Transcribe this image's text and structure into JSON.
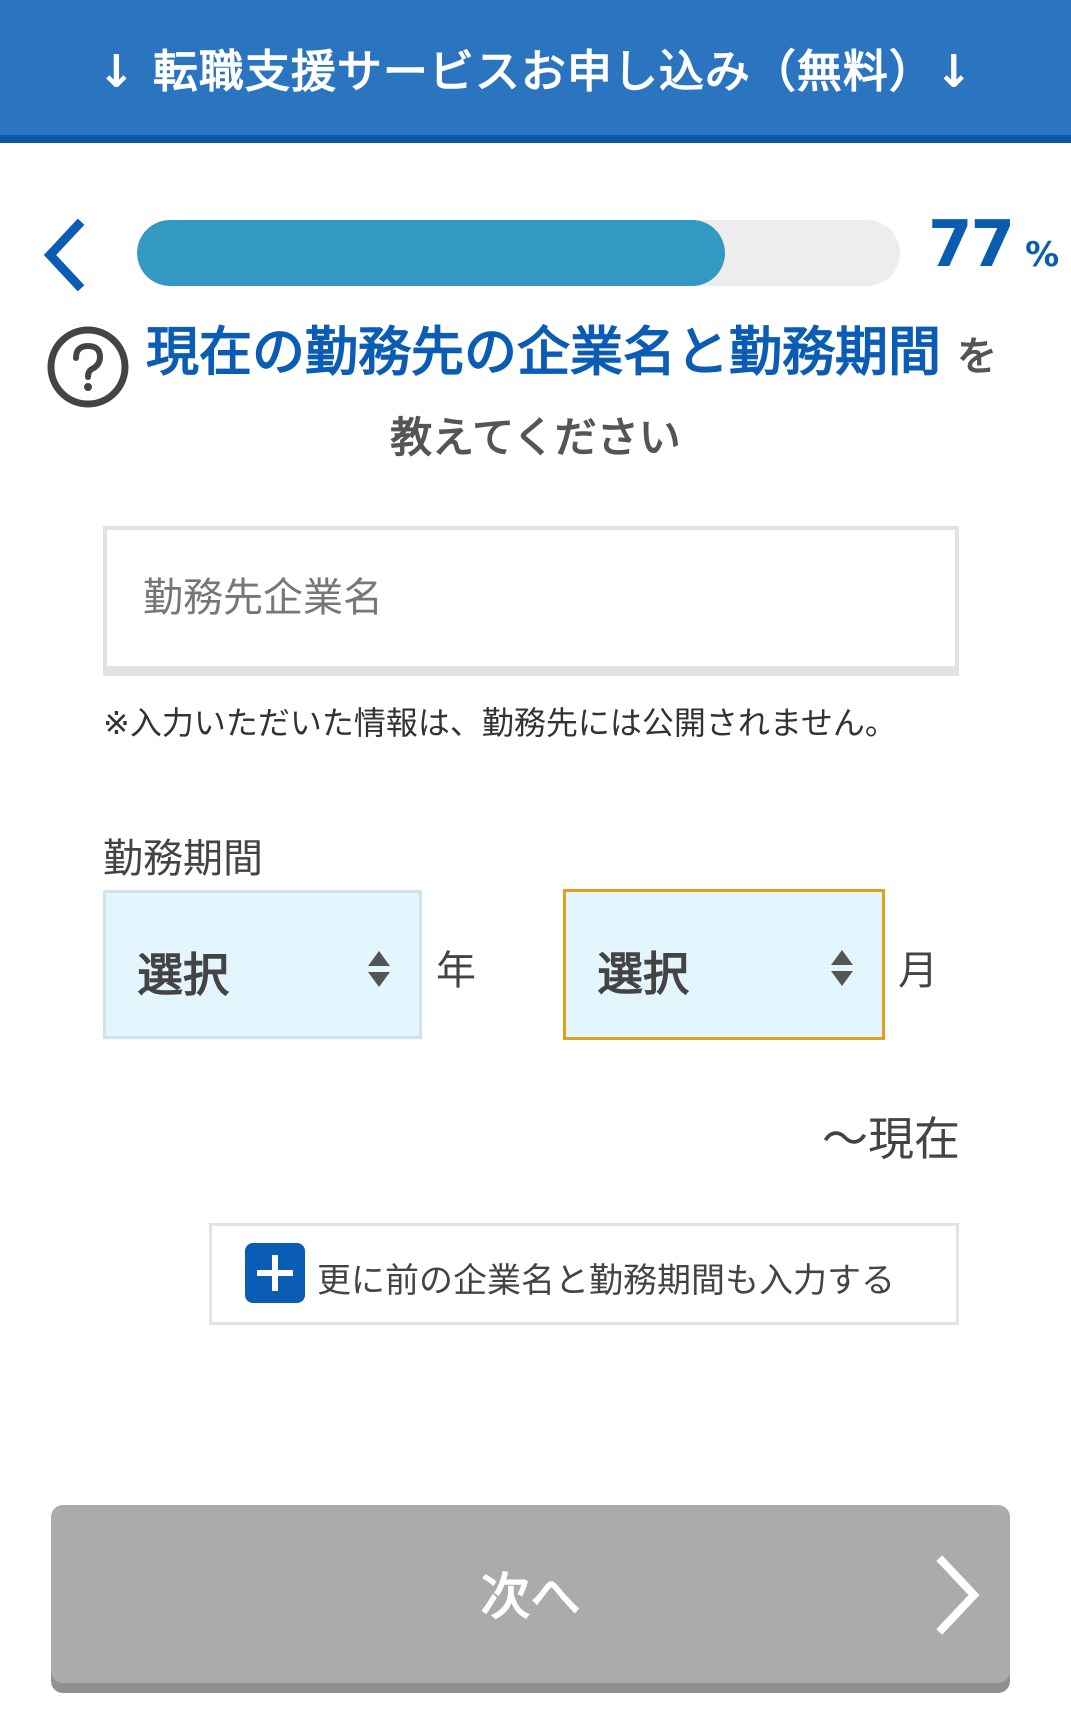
{
  "header": {
    "title": "↓ 転職支援サービスお申し込み（無料）↓"
  },
  "progress": {
    "percent_value": "77",
    "percent_unit": "%",
    "fraction": 0.77
  },
  "question": {
    "highlight": "現在の勤務先の企業名と勤務期間",
    "particle": "を",
    "line2": "教えてください"
  },
  "company_field": {
    "placeholder": "勤務先企業名",
    "value": ""
  },
  "note": "※入力いただいた情報は、勤務先には公開されません。",
  "period": {
    "label": "勤務期間",
    "year_select": "選択",
    "year_unit": "年",
    "month_select": "選択",
    "month_unit": "月",
    "until_now": "〜現在"
  },
  "add_more": {
    "label": "更に前の企業名と勤務期間も入力する"
  },
  "next_button": {
    "label": "次へ"
  },
  "colors": {
    "header_bg": "#2b74c0",
    "accent_blue": "#0b5cb5",
    "progress_fill": "#3399c3",
    "select_bg": "#e4f6fd",
    "select_focus_border": "#e3a020",
    "next_btn_bg": "#ababab"
  },
  "icons": [
    "back-chevron-icon",
    "help-question-icon",
    "select-arrows-icon",
    "plus-icon",
    "chevron-right-icon"
  ]
}
